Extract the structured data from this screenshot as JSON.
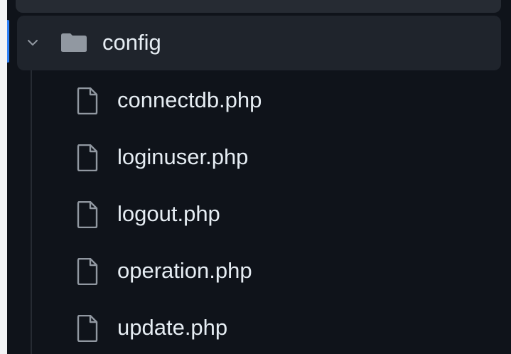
{
  "explorer": {
    "folder": {
      "name": "config",
      "expanded": true,
      "icon": "folder-icon",
      "chevron": "chevron-down-icon"
    },
    "files": [
      {
        "name": "connectdb.php",
        "icon": "file-icon"
      },
      {
        "name": "loginuser.php",
        "icon": "file-icon"
      },
      {
        "name": "logout.php",
        "icon": "file-icon"
      },
      {
        "name": "operation.php",
        "icon": "file-icon"
      },
      {
        "name": "update.php",
        "icon": "file-icon"
      }
    ]
  },
  "colors": {
    "background": "#0f131a",
    "row_highlight": "#1f242c",
    "text": "#e6edf3",
    "icon": "#9198a1",
    "active_marker": "#2f81f7"
  }
}
